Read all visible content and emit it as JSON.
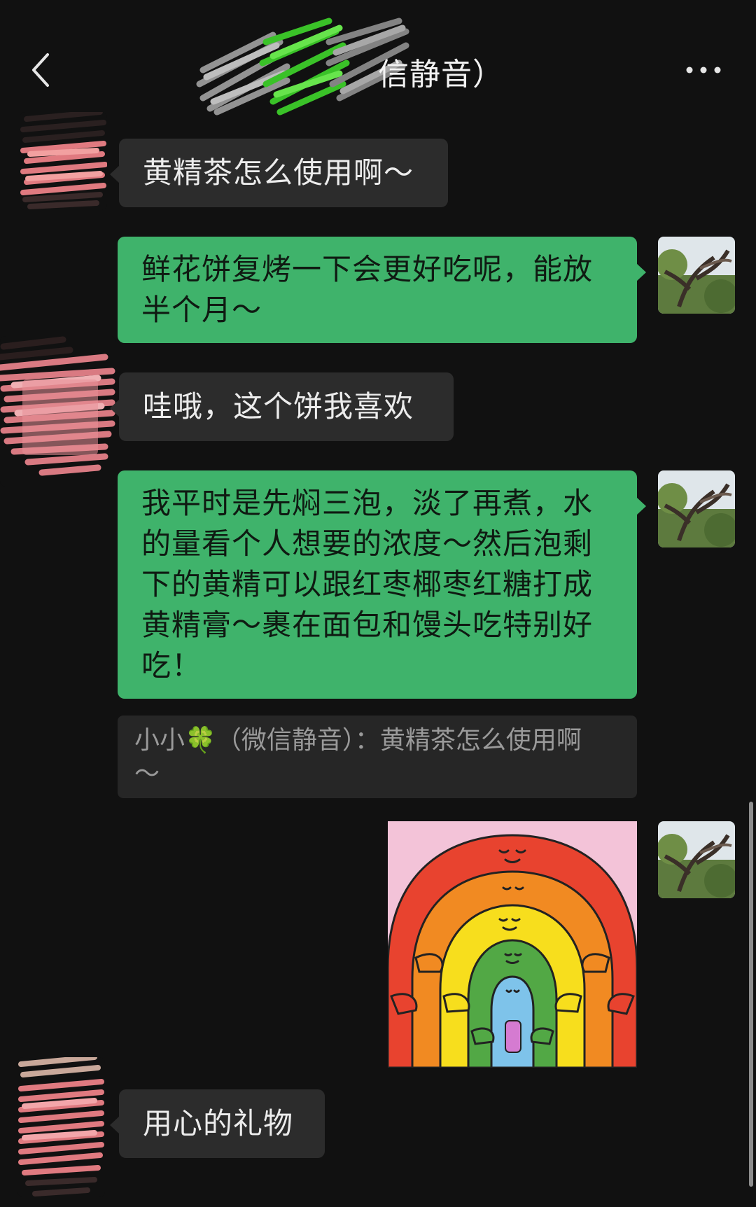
{
  "header": {
    "title_visible": "信静音）",
    "back_icon": "chevron-left-icon",
    "more_icon": "more-dots-icon"
  },
  "messages": {
    "m1": "黄精茶怎么使用啊～",
    "m2_line1": "鲜花饼复烤一下会更好吃呢，能放",
    "m2_line2": "半个月～",
    "m3": "哇哦，这个饼我喜欢",
    "m4_line1": "我平时是先焖三泡，淡了再煮，水",
    "m4_line2": "的量看个人想要的浓度～然后泡剩",
    "m4_line3": "下的黄精可以跟红枣椰枣红糖打成",
    "m4_line4": "黄精膏～裹在面包和馒头吃特别好",
    "m4_line5": "吃！",
    "quote_line1": "小小🍀（微信静音）：黄精茶怎么使用啊",
    "quote_line2": "～",
    "m5": "用心的礼物"
  },
  "colors": {
    "background": "#111111",
    "incoming_bubble": "#2c2c2c",
    "outgoing_bubble": "#3fb36b"
  }
}
